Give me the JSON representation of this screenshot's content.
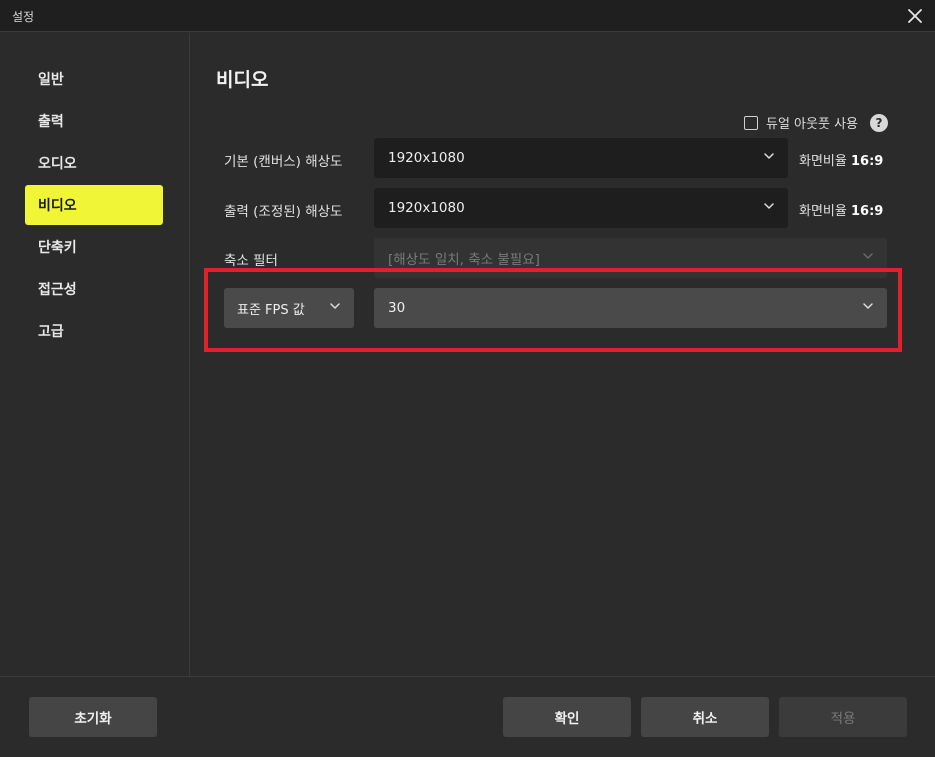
{
  "window": {
    "title": "설정"
  },
  "sidebar": {
    "items": [
      {
        "label": "일반",
        "active": false
      },
      {
        "label": "출력",
        "active": false
      },
      {
        "label": "오디오",
        "active": false
      },
      {
        "label": "비디오",
        "active": true
      },
      {
        "label": "단축키",
        "active": false
      },
      {
        "label": "접근성",
        "active": false
      },
      {
        "label": "고급",
        "active": false
      }
    ]
  },
  "video": {
    "title": "비디오",
    "dual_output": {
      "label": "듀얼 아웃풋 사용",
      "checked": false
    },
    "base_resolution": {
      "label": "기본 (캔버스) 해상도",
      "value": "1920x1080",
      "ratio_label": "화면비율",
      "ratio": "16:9"
    },
    "output_resolution": {
      "label": "출력 (조정된) 해상도",
      "value": "1920x1080",
      "ratio_label": "화면비율",
      "ratio": "16:9"
    },
    "downscale_filter": {
      "label": "축소 필터",
      "placeholder": "[해상도 일치, 축소 불필요]"
    },
    "fps": {
      "type_label": "표준 FPS 값",
      "value": "30"
    }
  },
  "footer": {
    "reset_label": "초기화",
    "ok_label": "확인",
    "cancel_label": "취소",
    "apply_label": "적용"
  },
  "colors": {
    "accent": "#f0f535",
    "highlight_box": "#e0202a",
    "background": "#2b2b2b"
  }
}
